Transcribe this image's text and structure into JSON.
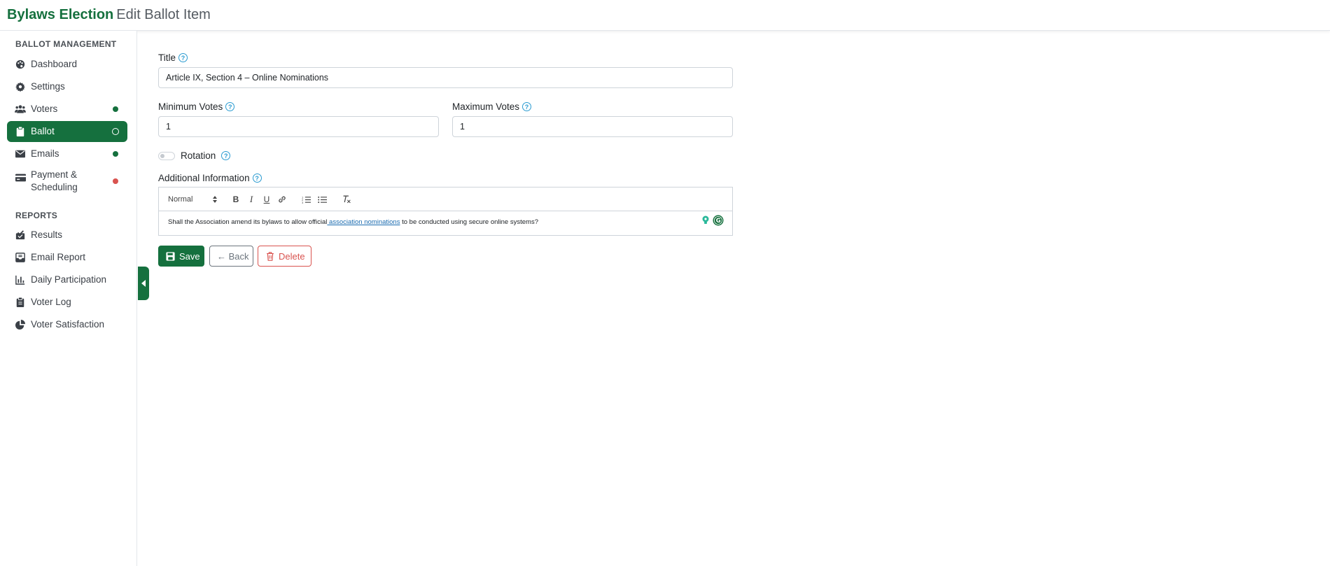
{
  "header": {
    "brand": "Bylaws Election",
    "page_title": "Edit Ballot Item"
  },
  "sidebar": {
    "sections": [
      {
        "label": "BALLOT MANAGEMENT",
        "items": [
          {
            "label": "Dashboard",
            "icon": "palette-icon"
          },
          {
            "label": "Settings",
            "icon": "gear-icon"
          },
          {
            "label": "Voters",
            "icon": "users-icon",
            "status": "complete",
            "status_color": "#15703e"
          },
          {
            "label": "Ballot",
            "icon": "clipboard-icon",
            "status": "in-progress",
            "active": true
          },
          {
            "label": "Emails",
            "icon": "envelope-icon",
            "status": "complete",
            "status_color": "#15703e"
          },
          {
            "label": "Payment & Scheduling",
            "icon": "credit-card-icon",
            "status": "incomplete",
            "status_color": "#d9534f"
          }
        ]
      },
      {
        "label": "REPORTS",
        "items": [
          {
            "label": "Results",
            "icon": "check-box-icon"
          },
          {
            "label": "Email Report",
            "icon": "inbox-icon"
          },
          {
            "label": "Daily Participation",
            "icon": "bar-chart-icon"
          },
          {
            "label": "Voter Log",
            "icon": "clipboard-list-icon"
          },
          {
            "label": "Voter Satisfaction",
            "icon": "pie-chart-icon"
          }
        ]
      }
    ]
  },
  "form": {
    "title_label": "Title",
    "title_value": "Article IX, Section 4 – Online Nominations",
    "min_votes_label": "Minimum Votes",
    "min_votes_value": "1",
    "max_votes_label": "Maximum Votes",
    "max_votes_value": "1",
    "rotation_label": "Rotation",
    "rotation_enabled": false,
    "additional_info_label": "Additional Information",
    "editor": {
      "format_select": "Normal",
      "content_before": "Shall the Association amend its bylaws to allow official",
      "content_link": " association nominations",
      "content_after": " to be conducted using secure online systems?"
    }
  },
  "actions": {
    "save_label": "Save",
    "back_label": "← Back",
    "delete_label": "Delete"
  },
  "colors": {
    "brand": "#15703e",
    "help": "#2a9bd1",
    "danger": "#d9534f",
    "secondary": "#6c757d"
  }
}
